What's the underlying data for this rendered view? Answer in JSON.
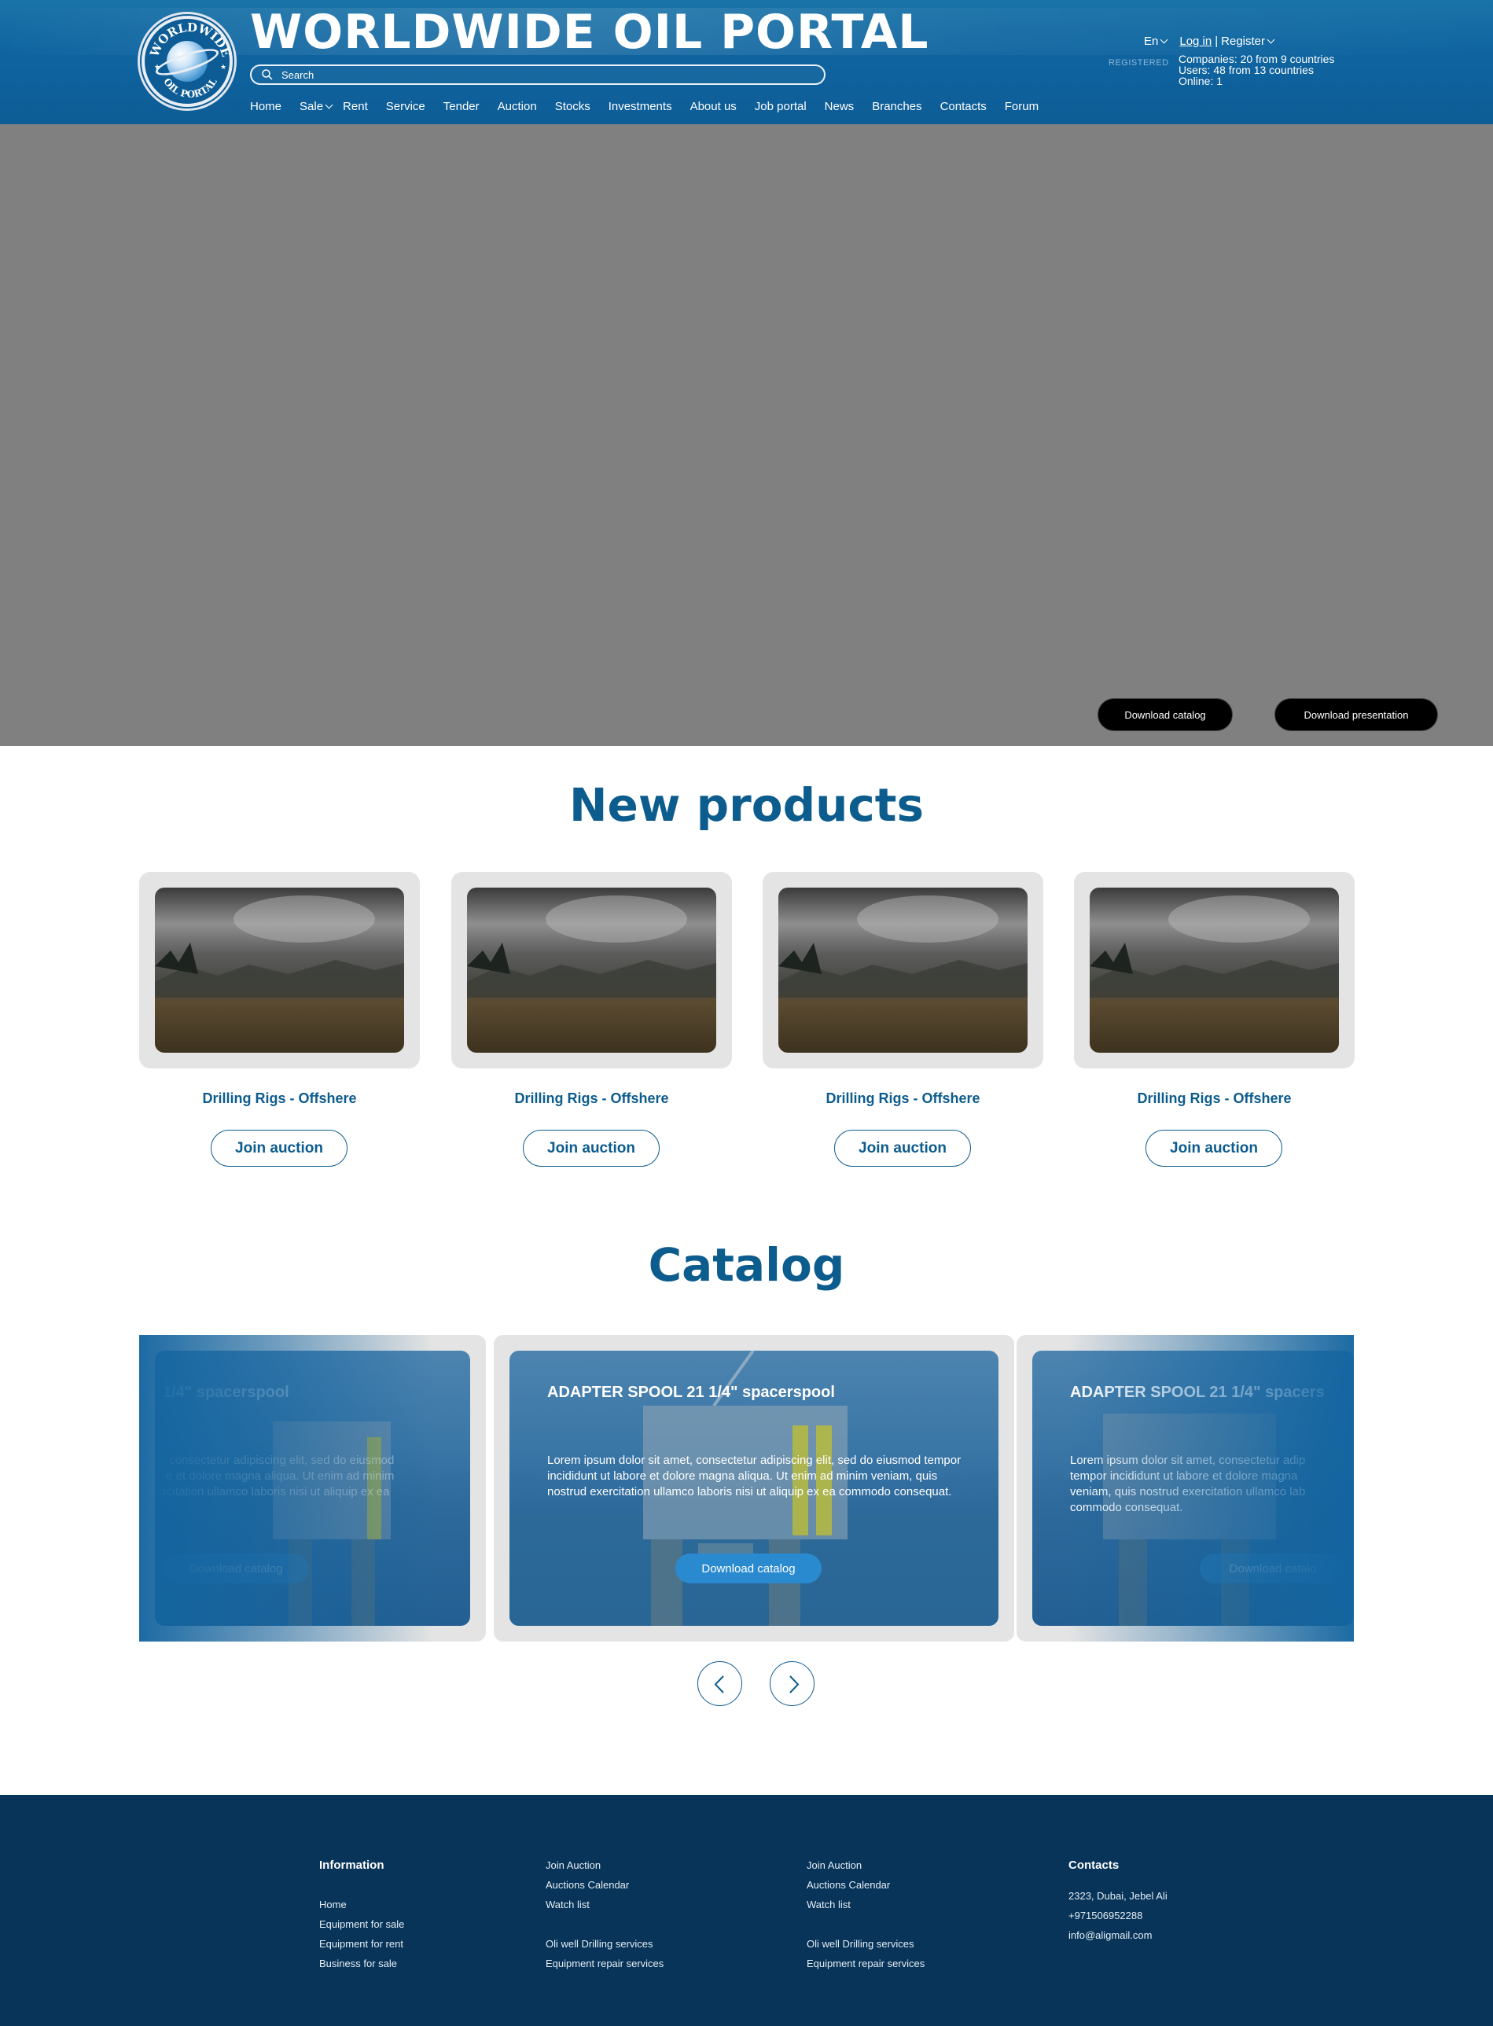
{
  "header": {
    "site_title": "WORLDWIDE OIL PORTAL",
    "logo_text_top": "WORLDWIDE",
    "logo_text_bottom": "OIL PORTAL",
    "search_placeholder": "Search",
    "language": "En",
    "login_label": "Log in",
    "separator": "|",
    "register_label": "Register",
    "registered_label": "REGISTERED",
    "stats": {
      "companies": "Companies: 20 from 9 countries",
      "users": "Users: 48 from 13 countries",
      "online": "Online: 1"
    },
    "nav": [
      {
        "label": "Home"
      },
      {
        "label": "Sale"
      },
      {
        "label": "Rent"
      },
      {
        "label": "Service"
      },
      {
        "label": "Tender"
      },
      {
        "label": "Auction"
      },
      {
        "label": "Stocks"
      },
      {
        "label": "Investments"
      },
      {
        "label": "About us"
      },
      {
        "label": "Job portal"
      },
      {
        "label": "News"
      },
      {
        "label": "Branches"
      },
      {
        "label": "Contacts"
      },
      {
        "label": "Forum"
      }
    ]
  },
  "hero": {
    "download_catalog": "Download catalog",
    "download_presentation": "Download presentation"
  },
  "new_products": {
    "title": "New products",
    "items": [
      {
        "name": "Drilling Rigs - Offshere",
        "button": "Join auction"
      },
      {
        "name": "Drilling Rigs - Offshere",
        "button": "Join auction"
      },
      {
        "name": "Drilling Rigs - Offshere",
        "button": "Join auction"
      },
      {
        "name": "Drilling Rigs - Offshere",
        "button": "Join auction"
      }
    ]
  },
  "catalog": {
    "title": "Catalog",
    "left": {
      "title": "1/4\" spacerspool",
      "text": ", consectetur adipiscing elit, sed do eiusmod\n e et dolore magna aliqua. Ut enim ad minim\nrcitation ullamco laboris nisi ut aliquip ex ea",
      "button": "Download catalog"
    },
    "center": {
      "title": "ADAPTER SPOOL 21 1/4\" spacerspool",
      "text": "Lorem ipsum dolor sit amet, consectetur adipiscing elit, sed do eiusmod tempor incididunt ut labore et dolore magna aliqua. Ut enim ad minim veniam, quis nostrud exercitation ullamco laboris nisi ut aliquip ex ea commodo consequat.",
      "button": "Download catalog"
    },
    "right": {
      "title": "ADAPTER SPOOL 21 1/4\" spacers",
      "text": "Lorem ipsum dolor sit amet, consectetur adip\ntempor incididunt ut labore et dolore magna\nveniam, quis nostrud exercitation ullamco lab\ncommodo consequat.",
      "button": "Download catalo"
    }
  },
  "footer": {
    "col1": {
      "head": "Information",
      "links": [
        "Home",
        "Equipment for sale",
        "Equipment for rent",
        "Business for sale"
      ]
    },
    "col2": {
      "links_a": [
        "Join Auction",
        "Auctions Calendar",
        "Watch list"
      ],
      "links_b": [
        "Oli well Drilling services",
        "Equipment repair services"
      ]
    },
    "col3": {
      "links_a": [
        "Join Auction",
        "Auctions Calendar",
        "Watch list"
      ],
      "links_b": [
        "Oli well Drilling services",
        "Equipment repair services"
      ]
    },
    "col4": {
      "head": "Contacts",
      "address": "2323, Dubai, Jebel Ali",
      "phone": "+971506952288",
      "email": "info@aligmail.com"
    }
  },
  "colors": {
    "header_blue": "#0f64a0",
    "title_blue": "#0d5c8e",
    "footer_navy": "#073458",
    "hero_gray": "#808080",
    "button_blue": "#2a8ad0"
  }
}
